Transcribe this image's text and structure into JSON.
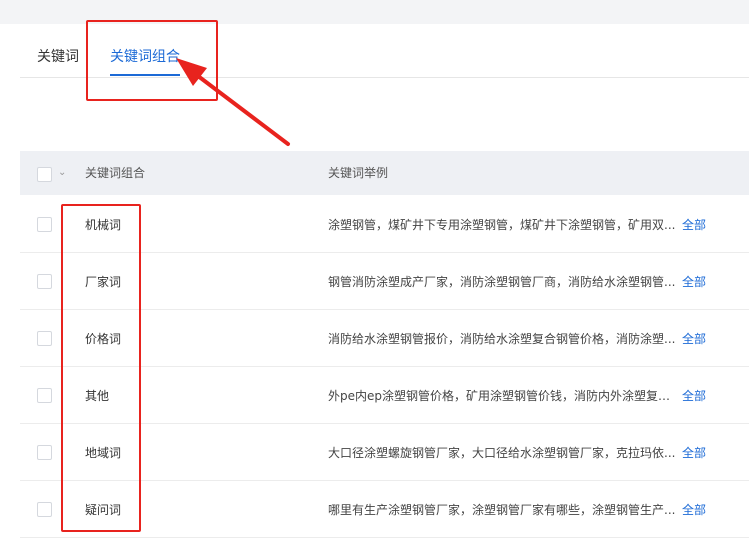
{
  "tabs": [
    {
      "label": "关键词",
      "active": false
    },
    {
      "label": "关键词组合",
      "active": true
    }
  ],
  "table": {
    "columns": [
      "关键词组合",
      "关键词举例"
    ],
    "rows": [
      {
        "name": "机械词",
        "examples": "涂塑钢管，煤矿井下专用涂塑钢管，煤矿井下涂塑钢管，矿用双...",
        "more": "全部"
      },
      {
        "name": "厂家词",
        "examples": "钢管消防涂塑成产厂家，消防涂塑钢管厂商，消防给水涂塑钢管...",
        "more": "全部"
      },
      {
        "name": "价格词",
        "examples": "消防给水涂塑钢管报价，消防给水涂塑复合钢管价格，消防涂塑...",
        "more": "全部"
      },
      {
        "name": "其他",
        "examples": "外pe内ep涂塑钢管价格，矿用涂塑钢管价钱，消防内外涂塑复合...",
        "more": "全部"
      },
      {
        "name": "地域词",
        "examples": "大口径涂塑螺旋钢管厂家，大口径给水涂塑钢管厂家，克拉玛依...",
        "more": "全部"
      },
      {
        "name": "疑问词",
        "examples": "哪里有生产涂塑钢管厂家，涂塑钢管厂家有哪些，涂塑钢管生产...",
        "more": "全部"
      }
    ]
  },
  "colors": {
    "accent": "#1c6ad6",
    "annotation": "#e8231e",
    "header_bg": "#eef0f4"
  },
  "icons": {
    "header_dropdown": "chevron-down-icon",
    "annotation_arrow": "red-arrow-icon"
  }
}
